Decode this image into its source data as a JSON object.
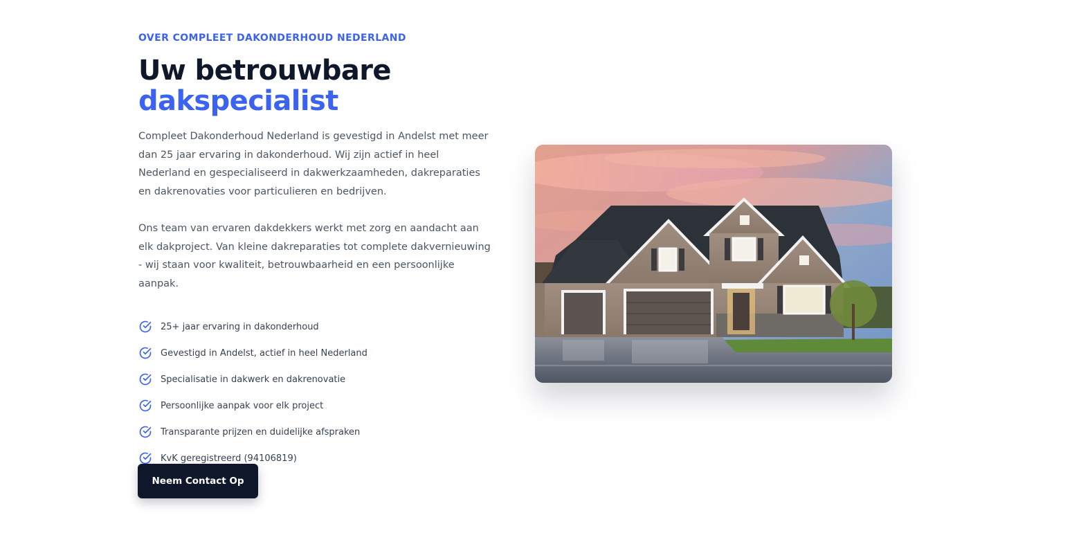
{
  "about": {
    "eyebrow": "OVER COMPLEET DAKONDERHOUD NEDERLAND",
    "heading_line1": "Uw betrouwbare",
    "heading_accent": "dakspecialist",
    "paragraph1": "Compleet Dakonderhoud Nederland is gevestigd in Andelst met meer dan 25 jaar ervaring in dakonderhoud. Wij zijn actief in heel Nederland en gespecialiseerd in dakwerkzaamheden, dakreparaties en dakrenovaties voor particulieren en bedrijven.",
    "paragraph2": "Ons team van ervaren dakdekkers werkt met zorg en aandacht aan elk dakproject. Van kleine dakreparaties tot complete dakvernieuwing - wij staan voor kwaliteit, betrouwbaarheid en een persoonlijke aanpak.",
    "features": [
      "25+ jaar ervaring in dakonderhoud",
      "Gevestigd in Andelst, actief in heel Nederland",
      "Specialisatie in dakwerk en dakrenovatie",
      "Persoonlijke aanpak voor elk project",
      "Transparante prijzen en duidelijke afspraken",
      "KvK geregistreerd (94106819)"
    ],
    "feature_icon": "check-circle-icon",
    "cta_label": "Neem Contact Op",
    "image_subject": "house-photo"
  },
  "colors": {
    "accent": "#3b63f0",
    "heading": "#0f172a",
    "body_text": "#4b5563",
    "button_bg": "#0f172a",
    "button_text": "#ffffff"
  }
}
